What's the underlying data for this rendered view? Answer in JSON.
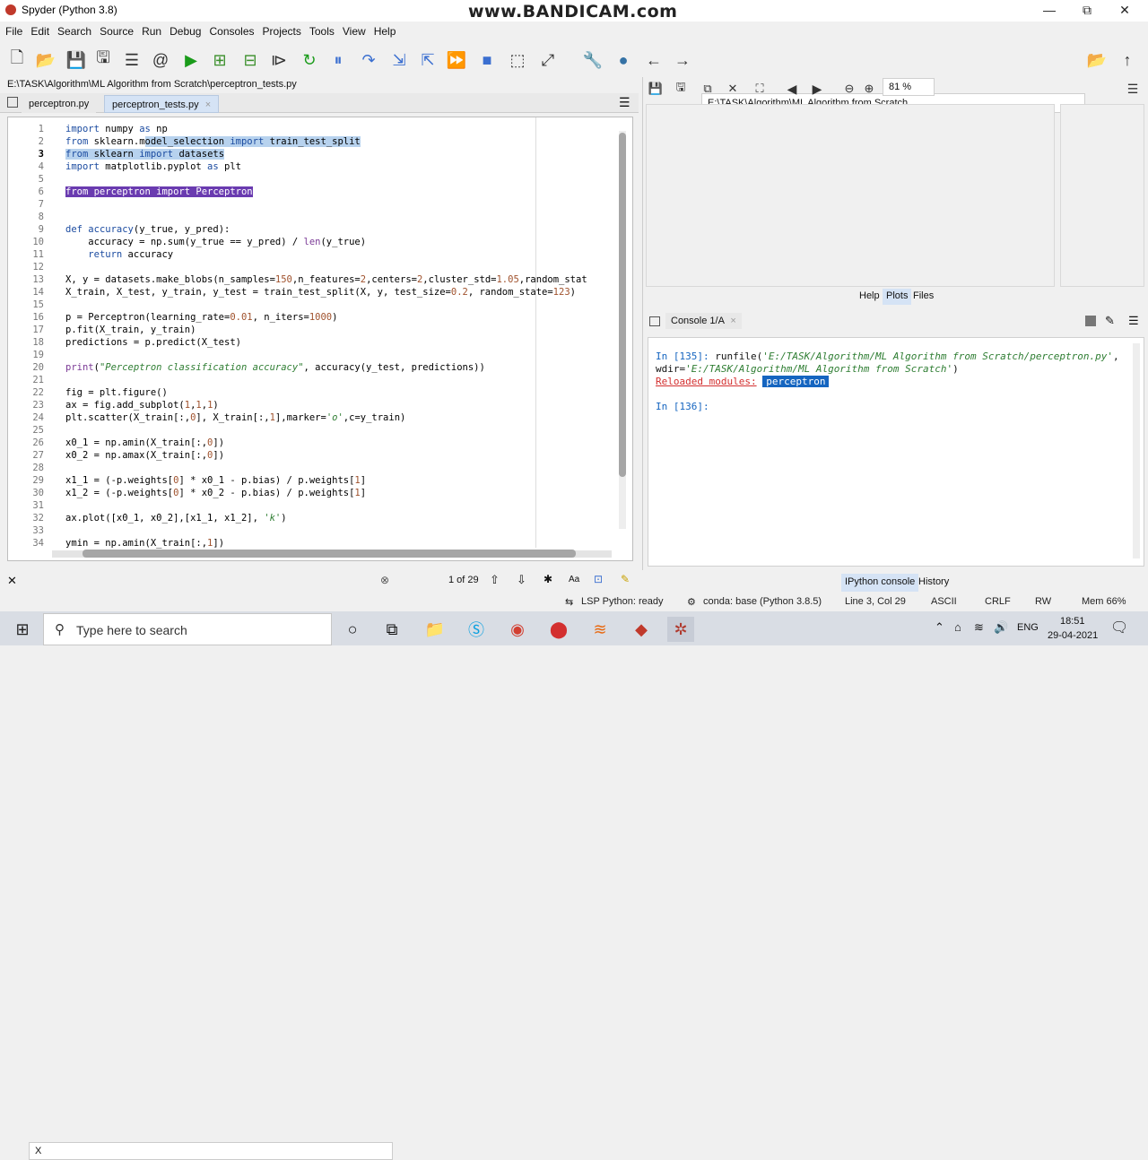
{
  "window": {
    "title": "Spyder (Python 3.8)",
    "watermark": "www.BANDICAM.com",
    "min": "—",
    "restore": "⧉",
    "close": "✕"
  },
  "menu": [
    "File",
    "Edit",
    "Search",
    "Source",
    "Run",
    "Debug",
    "Consoles",
    "Projects",
    "Tools",
    "View",
    "Help"
  ],
  "toolbar": {
    "path": "E:\\TASK\\Algorithm\\ML Algorithm from Scratch"
  },
  "editor": {
    "filepath": "E:\\TASK\\Algorithm\\ML Algorithm from Scratch\\perceptron_tests.py",
    "tabs": [
      "perceptron.py",
      "perceptron_tests.py"
    ],
    "lines": [
      "import numpy as np",
      "from sklearn.model_selection import train_test_split",
      "from sklearn import datasets",
      "import matplotlib.pyplot as plt",
      "",
      "from perceptron import Perceptron",
      "",
      "",
      "def accuracy(y_true, y_pred):",
      "    accuracy = np.sum(y_true == y_pred) / len(y_true)",
      "    return accuracy",
      "",
      "X, y = datasets.make_blobs(n_samples=150,n_features=2,centers=2,cluster_std=1.05,random_stat",
      "X_train, X_test, y_train, y_test = train_test_split(X, y, test_size=0.2, random_state=123)",
      "",
      "p = Perceptron(learning_rate=0.01, n_iters=1000)",
      "p.fit(X_train, y_train)",
      "predictions = p.predict(X_test)",
      "",
      "print(\"Perceptron classification accuracy\", accuracy(y_test, predictions))",
      "",
      "fig = plt.figure()",
      "ax = fig.add_subplot(1,1,1)",
      "plt.scatter(X_train[:,0], X_train[:,1],marker='o',c=y_train)",
      "",
      "x0_1 = np.amin(X_train[:,0])",
      "x0_2 = np.amax(X_train[:,0])",
      "",
      "x1_1 = (-p.weights[0] * x0_1 - p.bias) / p.weights[1]",
      "x1_2 = (-p.weights[0] * x0_2 - p.bias) / p.weights[1]",
      "",
      "ax.plot([x0_1, x0_2],[x1_1, x1_2], 'k')",
      "",
      "ymin = np.amin(X_train[:,1])"
    ],
    "current_line": 3
  },
  "find": {
    "query": "X",
    "count": "1 of 29",
    "case_label": "Aa"
  },
  "plots": {
    "zoom": "81 %",
    "tabs": [
      "Help",
      "Plots",
      "Files"
    ]
  },
  "console": {
    "tab_label": "Console 1/A",
    "line1_prompt": "In [135]: ",
    "line1_cmd": "runfile(",
    "line1_arg": "'E:/TASK/Algorithm/ML Algorithm from Scratch/perceptron.py'",
    "line1_end": ",",
    "line2_kw": "wdir=",
    "line2_arg": "'E:/TASK/Algorithm/ML Algorithm from Scratch'",
    "line2_end": ")",
    "reloaded_label": "Reloaded modules",
    "reloaded_sep": ":",
    "reloaded_module": "perceptron",
    "prompt2": "In [136]:",
    "bottom_tabs": [
      "IPython console",
      "History"
    ]
  },
  "status": {
    "lsp": "LSP Python: ready",
    "conda": "conda: base (Python 3.8.5)",
    "cursor": "Line 3, Col 29",
    "encoding": "ASCII",
    "eol": "CRLF",
    "perm": "RW",
    "mem": "Mem 66%"
  },
  "taskbar": {
    "search_placeholder": "Type here to search",
    "lang": "ENG",
    "time": "18:51",
    "date": "29-04-2021"
  }
}
